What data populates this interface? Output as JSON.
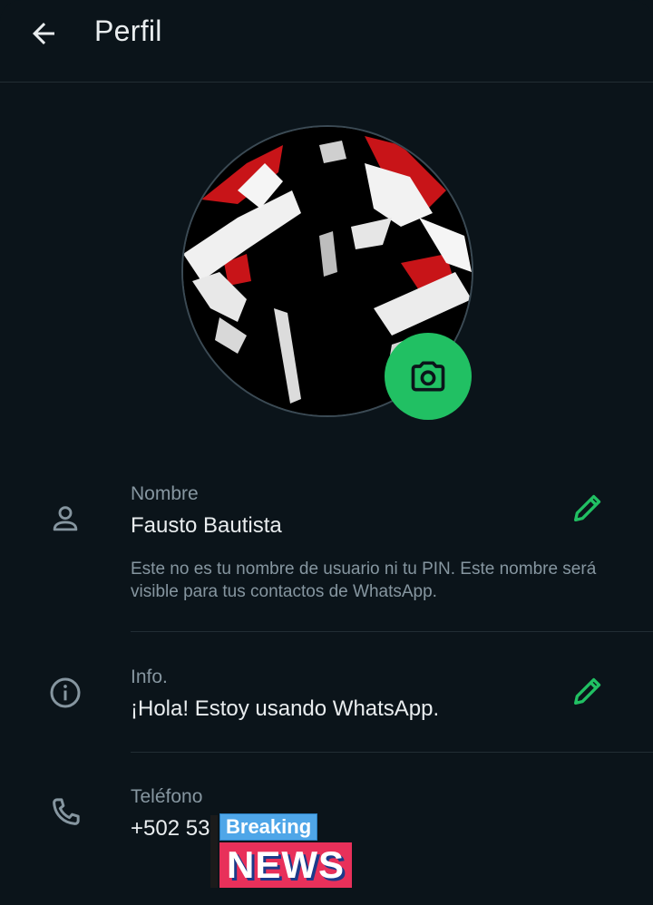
{
  "header": {
    "title": "Perfil",
    "back_icon": "arrow-back-icon"
  },
  "avatar": {
    "camera_icon": "camera-icon",
    "accent": "#21c063"
  },
  "name": {
    "label": "Nombre",
    "value": "Fausto Bautista",
    "hint": "Este no es tu nombre de usuario ni tu PIN. Este nombre será visible para tus contactos de WhatsApp."
  },
  "info": {
    "label": "Info.",
    "value": "¡Hola! Estoy usando WhatsApp."
  },
  "phone": {
    "label": "Teléfono",
    "value": "+502 53"
  },
  "overlay": {
    "breaking": "Breaking",
    "news": "NEWS"
  }
}
